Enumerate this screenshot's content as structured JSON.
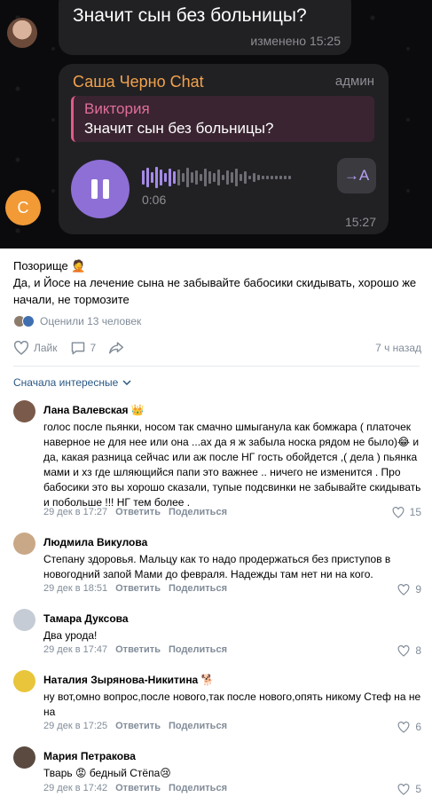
{
  "screenshot": {
    "top_message": {
      "text": "Значит сын без больницы?",
      "meta": "изменено 15:25"
    },
    "voice_message": {
      "sender": "Саша Черно Chat",
      "role": "админ",
      "reply_name": "Виктория",
      "reply_text": "Значит сын без больницы?",
      "duration": "0:06",
      "transcribe_label": "→A",
      "time": "15:27",
      "avatar_letter": "С"
    },
    "colors": {
      "sender": "#f2a24c",
      "reply_name": "#e06e98",
      "play_button": "#8e6fd6"
    }
  },
  "post": {
    "text_line1": "Позорище 🤦",
    "text_line2": "Да, и Йосе на лечение сына не забывайте бабосики скидывать, хорошо же начали, не тормозите",
    "likers_text": "Оценили 13 человек",
    "like_label": "Лайк",
    "comments_count": "7",
    "time": "7 ч назад"
  },
  "sort_label": "Сначала интересные",
  "comments": [
    {
      "name": "Лана Валевская 👑",
      "text": "голос после пьянки, носом так смачно шмыганула как бомжара ( платочек наверное не для нее или она ...ах да я ж забыла носка рядом не было)😂 и да, какая разница сейчас или аж после НГ гость обойдется ,( дела ) пьянка мами и хз где шляющийся папи это важнее .. ничего не изменится . Про бабосики это вы хорошо сказали, тупые подсвинки не забывайте скидывать и побольше !!! НГ тем более .",
      "date": "29 дек в 17:27",
      "reply": "Ответить",
      "share": "Поделиться",
      "likes": "15",
      "avatar_color": "#7a5a4a"
    },
    {
      "name": "Людмила Викулова",
      "text": "Степану здоровья. Мальцу как то надо продержаться без приступов в новогодний запой Мами до февраля. Надежды там нет ни на кого.",
      "date": "29 дек в 18:51",
      "reply": "Ответить",
      "share": "Поделиться",
      "likes": "9",
      "avatar_color": "#c9a887"
    },
    {
      "name": "Тамара Дуксова",
      "text": "Два урода!",
      "date": "29 дек в 17:47",
      "reply": "Ответить",
      "share": "Поделиться",
      "likes": "8",
      "avatar_color": "#c5ccd6"
    },
    {
      "name": "Наталия Зырянова-Никитина 🐕",
      "text": "ну вот,омно вопрос,после нового,так после нового,опять никому Стеф на не на",
      "date": "29 дек в 17:25",
      "reply": "Ответить",
      "share": "Поделиться",
      "likes": "6",
      "avatar_color": "#e8c53a"
    },
    {
      "name": "Мария Петракова",
      "text": "Тварь 😡 бедный Стёпа😢",
      "date": "29 дек в 17:42",
      "reply": "Ответить",
      "share": "Поделиться",
      "likes": "5",
      "avatar_color": "#5a4a40"
    }
  ]
}
